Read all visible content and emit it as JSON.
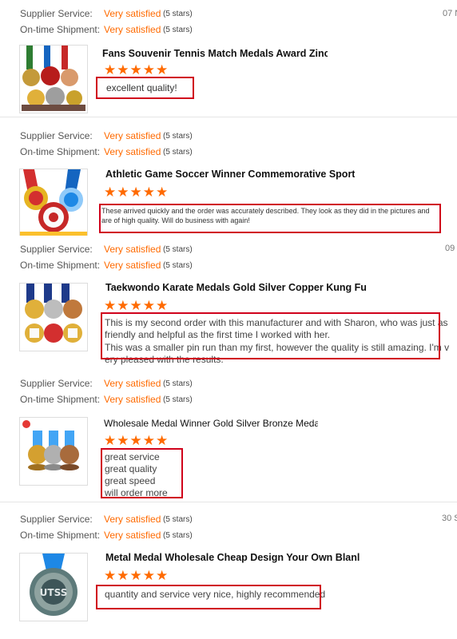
{
  "labels": {
    "supplier_service": "Supplier Service:",
    "on_time_shipment": "On-time Shipment:",
    "very_satisfied": "Very satisfied",
    "five_stars": "(5 stars)"
  },
  "colors": {
    "accent": "#ff6a00",
    "highlight_box": "#d0021b"
  },
  "reviews": [
    {
      "date": "07 N",
      "product_title": "Fans Souvenir Tennis Match Medals Award Zinc Allo L...",
      "rating_stars": "★★★★★",
      "comment_lines": [
        "excellent quality!"
      ]
    },
    {
      "date": "",
      "product_title": "Athletic Game Soccer Winner Commemorative Sports Ath",
      "rating_stars": "★★★★★",
      "comment_lines": [
        "These arrived quickly and the order was accurately described. They look as they did in the pictures and",
        "are of high quality. Will do business with again!"
      ]
    },
    {
      "date": "09 I",
      "product_title": "Taekwondo Karate Medals Gold Silver Copper Kung Fu Judo",
      "rating_stars": "★★★★★",
      "comment_lines": [
        "This is my second order with this manufacturer and with Sharon, who was just as",
        "friendly and helpful as the first time I worked with her.",
        "This was a smaller pin run than my first, however the quality is still amazing. I'm v",
        "ery pleased with the results."
      ]
    },
    {
      "date": "",
      "product_title": "Wholesale Medal Winner Gold Silver Bronze Medal with",
      "rating_stars": "★★★★★",
      "comment_lines": [
        "great service",
        "great quality",
        "great speed",
        "will order more"
      ]
    },
    {
      "date": "30 S",
      "product_title": "Metal Medal Wholesale Cheap Design Your Own Blanl",
      "rating_stars": "★★★★★",
      "comment_lines": [
        "quantity and service very nice, highly recommended"
      ],
      "thumb_logo_text": "UTSS"
    }
  ]
}
